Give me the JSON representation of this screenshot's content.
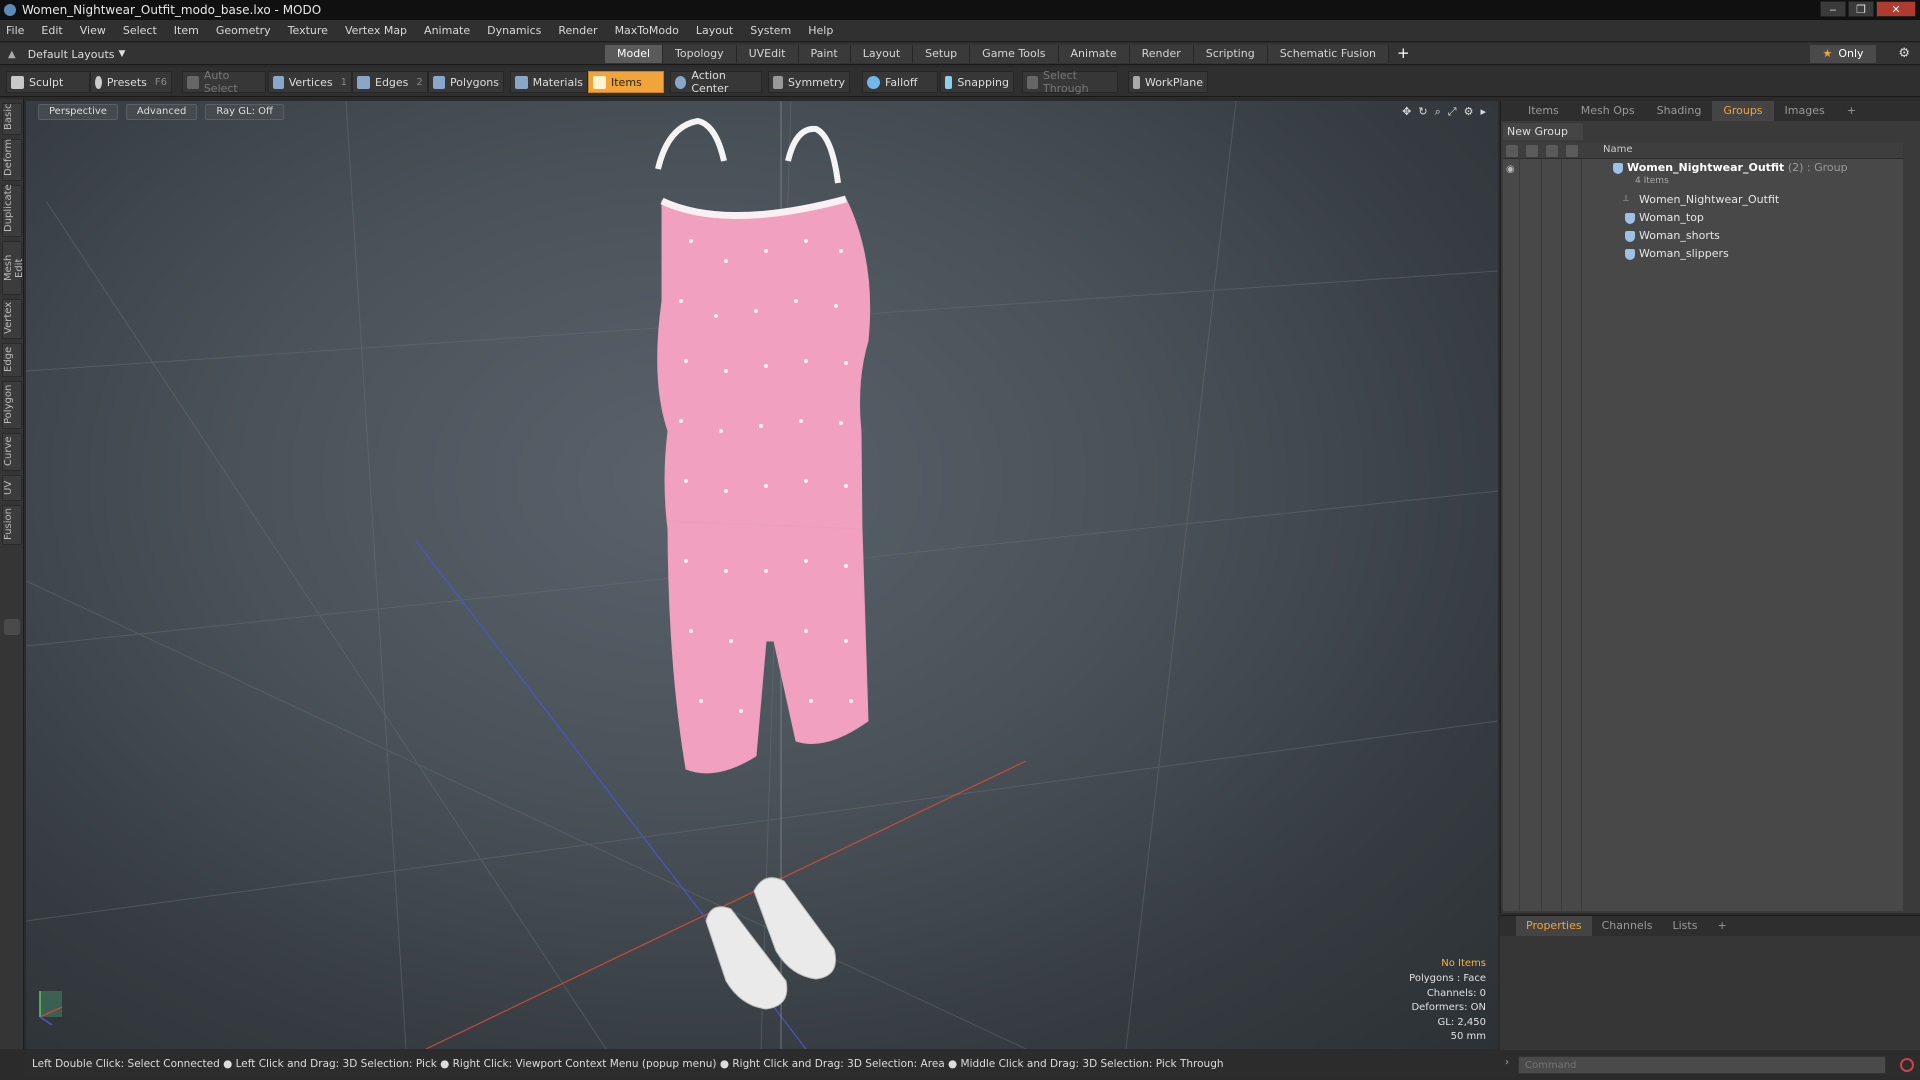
{
  "window": {
    "title": "Women_Nightwear_Outfit_modo_base.lxo - MODO"
  },
  "menu": [
    "File",
    "Edit",
    "View",
    "Select",
    "Item",
    "Geometry",
    "Texture",
    "Vertex Map",
    "Animate",
    "Dynamics",
    "Render",
    "MaxToModo",
    "Layout",
    "System",
    "Help"
  ],
  "layouts": {
    "label": "Default Layouts"
  },
  "layout_tabs": [
    "Model",
    "Topology",
    "UVEdit",
    "Paint",
    "Layout",
    "Setup",
    "Game Tools",
    "Animate",
    "Render",
    "Scripting",
    "Schematic Fusion"
  ],
  "active_layout_tab": "Model",
  "only_label": "Only",
  "toolbar": {
    "sculpt": "Sculpt",
    "presets": "Presets",
    "presets_key": "F6",
    "auto_select": "Auto Select",
    "vertices": "Vertices",
    "vertices_key": "1",
    "edges": "Edges",
    "edges_key": "2",
    "polygons": "Polygons",
    "materials": "Materials",
    "items": "Items",
    "action_center": "Action Center",
    "symmetry": "Symmetry",
    "falloff": "Falloff",
    "snapping": "Snapping",
    "select_through": "Select Through",
    "workplane": "WorkPlane"
  },
  "left_tabs": [
    "Basic",
    "Deform",
    "Duplicate",
    "Mesh Edit",
    "Vertex",
    "Edge",
    "Polygon",
    "Curve",
    "UV",
    "Fusion"
  ],
  "viewport": {
    "view": "Perspective",
    "mode": "Advanced",
    "raygl": "Ray GL: Off",
    "info": {
      "items": "No Items",
      "polygons": "Polygons : Face",
      "channels": "Channels: 0",
      "deformers": "Deformers: ON",
      "gl": "GL: 2,450",
      "scale": "50 mm"
    }
  },
  "right_tabs": [
    "Items",
    "Mesh Ops",
    "Shading",
    "Groups",
    "Images"
  ],
  "active_right_tab": "Groups",
  "groups": {
    "new_group": "New Group",
    "name_col": "Name",
    "group_name": "Women_Nightwear_Outfit",
    "group_meta": "(2) : Group",
    "group_sub": "4 Items",
    "children": [
      "Women_Nightwear_Outfit",
      "Woman_top",
      "Woman_shorts",
      "Woman_slippers"
    ]
  },
  "props_tabs": [
    "Properties",
    "Channels",
    "Lists"
  ],
  "status": "Left Double Click: Select Connected ● Left Click and Drag: 3D Selection: Pick ● Right Click: Viewport Context Menu (popup menu) ● Right Click and Drag: 3D Selection: Area ● Middle Click and Drag: 3D Selection: Pick Through",
  "command_placeholder": "Command",
  "colors": {
    "accent": "#f0a43a",
    "garment": "#f2a0bf",
    "axis_x": "#c84a3a",
    "axis_z": "#4a56c8"
  }
}
